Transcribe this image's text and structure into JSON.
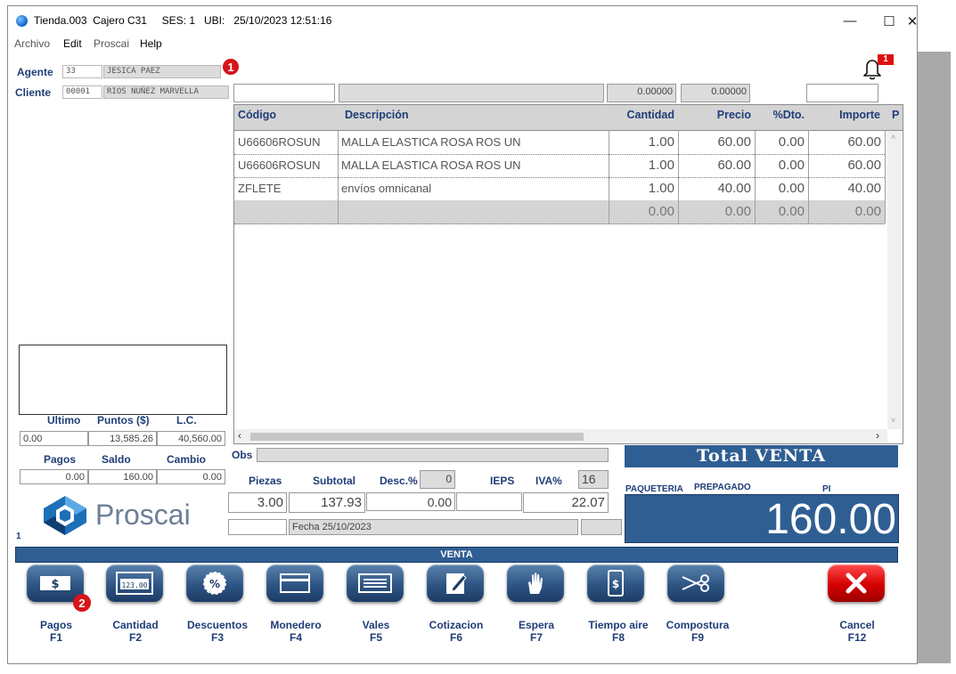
{
  "window": {
    "title": "Tienda.003  Cajero C31     SES: 1   UBI:   25/10/2023 12:51:16",
    "minimize": "—",
    "maximize": "☐",
    "close": "✕"
  },
  "menu": [
    "Archivo",
    "Edit",
    "Proscai",
    "Help"
  ],
  "agente": {
    "label": "Agente",
    "code": "33",
    "name": "JESICA PAEZ",
    "badge": "1"
  },
  "cliente": {
    "label": "Cliente",
    "code": "00001",
    "name": "RIOS NUÑEZ MARVELLA"
  },
  "notifications": {
    "count": "1"
  },
  "entry": {
    "qty": "0.00000",
    "price": "0.00000"
  },
  "grid": {
    "headers": [
      "Código",
      "Descripción",
      "Cantidad",
      "Precio",
      "%Dto.",
      "Importe",
      "P"
    ],
    "rows": [
      [
        "U66606ROSUN",
        "MALLA ELASTICA ROSA ROS UN",
        "1.00",
        "60.00",
        "0.00",
        "60.00"
      ],
      [
        "U66606ROSUN",
        "MALLA ELASTICA ROSA ROS UN",
        "1.00",
        "60.00",
        "0.00",
        "60.00"
      ],
      [
        "ZFLETE",
        "envíos omnicanal",
        "1.00",
        "40.00",
        "0.00",
        "40.00"
      ],
      [
        "",
        "",
        "0.00",
        "0.00",
        "0.00",
        "0.00"
      ]
    ]
  },
  "stats": {
    "ultimo_label": "Ultimo",
    "puntos_label": "Puntos ($)",
    "lc_label": "L.C.",
    "ultimo": "0.00",
    "puntos": "13,585.26",
    "lc": "40,560.00",
    "pagos_label": "Pagos",
    "saldo_label": "Saldo",
    "cambio_label": "Cambio",
    "pagos": "0.00",
    "saldo": "160.00",
    "cambio": "0.00"
  },
  "brand": {
    "name": "Proscai",
    "page_num": "1"
  },
  "obs": {
    "label": "Obs"
  },
  "totals": {
    "piezas_label": "Piezas",
    "subtotal_label": "Subtotal",
    "desc_label": "Desc.%",
    "desc_pct": "0",
    "ieps_label": "IEPS",
    "iva_label": "IVA%",
    "iva_pct": "16",
    "piezas": "3.00",
    "subtotal": "137.93",
    "desc": "0.00",
    "ieps": "",
    "iva": "22.07",
    "fecha": "Fecha 25/10/2023"
  },
  "total_panel": {
    "title": "Total VENTA",
    "paqueteria": "PAQUETERIA",
    "prepagado": "PREPAGADO",
    "pi": "PI",
    "amount": "160.00"
  },
  "mode_bar": "VENTA",
  "buttons": [
    {
      "name": "pagos-button",
      "icon": "cash-icon",
      "label": "Pagos",
      "key": "F1"
    },
    {
      "name": "cantidad-button",
      "icon": "calculator-icon",
      "label": "Cantidad",
      "key": "F2"
    },
    {
      "name": "descuentos-button",
      "icon": "percent-icon",
      "label": "Descuentos",
      "key": "F3"
    },
    {
      "name": "monedero-button",
      "icon": "wallet-card-icon",
      "label": "Monedero",
      "key": "F4"
    },
    {
      "name": "vales-button",
      "icon": "voucher-icon",
      "label": "Vales",
      "key": "F5"
    },
    {
      "name": "cotizacion-button",
      "icon": "quote-edit-icon",
      "label": "Cotizacion",
      "key": "F6"
    },
    {
      "name": "espera-button",
      "icon": "hand-icon",
      "label": "Espera",
      "key": "F7"
    },
    {
      "name": "tiempo-aire-button",
      "icon": "phone-dollar-icon",
      "label": "Tiempo aire",
      "key": "F8"
    },
    {
      "name": "compostura-button",
      "icon": "scissors-icon",
      "label": "Compostura",
      "key": "F9"
    }
  ],
  "cancel_button": {
    "label": "Cancel",
    "key": "F12"
  },
  "pagos_badge": "2",
  "colors": {
    "accent": "#2f5e93",
    "label": "#1f3d77",
    "badge": "#d7141a"
  }
}
